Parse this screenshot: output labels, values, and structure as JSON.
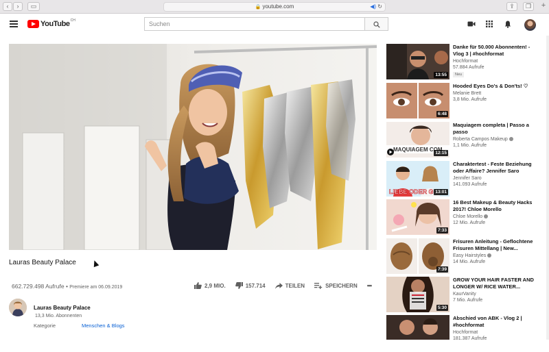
{
  "browser": {
    "url": "youtube.com",
    "back_glyph": "‹",
    "forward_glyph": "›",
    "sidebar_glyph": "▭",
    "lock_glyph": "🔒",
    "speaker_glyph": "◀)",
    "reload_glyph": "↻",
    "share_glyph": "⇪",
    "tabs_glyph": "❐",
    "newtab_glyph": "+"
  },
  "header": {
    "logo_text": "YouTube",
    "logo_region": "CH",
    "search_placeholder": "Suchen"
  },
  "video": {
    "title": "Lauras Beauty Palace",
    "views": "662.729.498 Aufrufe",
    "separator": " • ",
    "premiere": "Premiere am 06.09.2019",
    "likes": "2,9 MIO.",
    "dislikes": "157.714",
    "share_label": "TEILEN",
    "save_label": "SPEICHERN",
    "more_label": "•••"
  },
  "channel": {
    "name": "Lauras Beauty Palace",
    "subscribers": "13,3 Mio. Abonnenten",
    "category_label": "Kategorie",
    "category_value": "Menschen & Blogs"
  },
  "related": [
    {
      "title": "Danke für 50.000 Abonnenten! - Vlog 3 | #hochformat",
      "channel": "Hochformat",
      "views": "57.884 Aufrufe",
      "duration": "13:55",
      "badge": "Neu",
      "verified": false
    },
    {
      "title": "Hooded Eyes Do's & Don'ts! ♡",
      "channel": "Melanie Brett",
      "views": "3,8 Mio. Aufrufe",
      "duration": "6:48",
      "verified": false
    },
    {
      "title": "Maquiagem completa | Passo a passo",
      "channel": "Roberta Campos Makeup",
      "views": "1,1 Mio. Aufrufe",
      "duration": "12:15",
      "verified": true,
      "thumb_text": "MAQUIAGEM COM"
    },
    {
      "title": "Charaktertest - Feste Beziehung oder Affaire? Jennifer Saro",
      "channel": "Jennifer Saro",
      "views": "141.093 Aufrufe",
      "duration": "13:01",
      "verified": false,
      "thumb_text": "LIEBE ODER G"
    },
    {
      "title": "16 Best Makeup & Beauty Hacks 2017! Chloe Morello",
      "channel": "Chloe Morello",
      "views": "12 Mio. Aufrufe",
      "duration": "7:33",
      "verified": true
    },
    {
      "title": "Frisuren Anleitung - Geflochtene Frisuren Mittellang | New...",
      "channel": "Easy Hairstyles",
      "views": "14 Mio. Aufrufe",
      "duration": "7:39",
      "verified": true
    },
    {
      "title": "GROW YOUR HAIR FASTER AND LONGER W/ RICE WATER...",
      "channel": "KaurVanity",
      "views": "7 Mio. Aufrufe",
      "duration": "5:30",
      "verified": false
    },
    {
      "title": "Abschied von ABK - Vlog 2 | #hochformat",
      "channel": "Hochformat",
      "views": "181.387 Aufrufe",
      "duration": "",
      "verified": false
    }
  ]
}
